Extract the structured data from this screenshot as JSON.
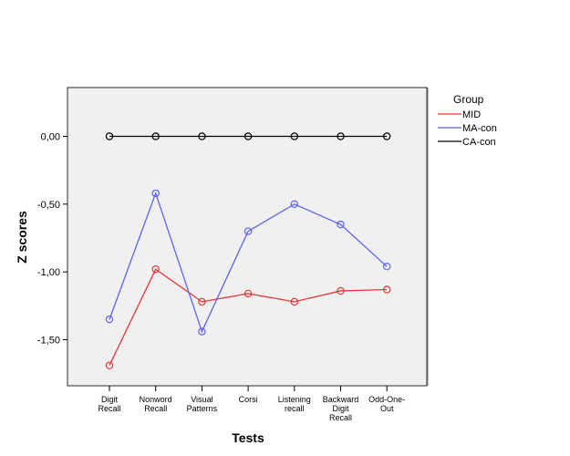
{
  "chart_data": {
    "type": "line",
    "title": "",
    "xlabel": "Tests",
    "ylabel": "Z scores",
    "ylim": [
      -1.84,
      0.36
    ],
    "yticks": [
      0.0,
      -0.5,
      -1.0,
      -1.5
    ],
    "ytick_labels": [
      "0,00",
      "-0,50",
      "-1,00",
      "-1,50"
    ],
    "grid": false,
    "categories": [
      [
        "Digit",
        "Recall"
      ],
      [
        "Nonword",
        "Recall"
      ],
      [
        "Visual",
        "Patterns"
      ],
      [
        "Corsi"
      ],
      [
        "Listening",
        "recall"
      ],
      [
        "Backward",
        "Digit",
        "Recall"
      ],
      [
        "Odd-One-",
        "Out"
      ]
    ],
    "legend": {
      "title": "Group",
      "placement": "right"
    },
    "series": [
      {
        "name": "MID",
        "color": "#e8363a",
        "values": [
          -1.69,
          -0.98,
          -1.22,
          -1.16,
          -1.22,
          -1.14,
          -1.13
        ]
      },
      {
        "name": "MA-con",
        "color": "#5c62ee",
        "values": [
          -1.35,
          -0.42,
          -1.44,
          -0.7,
          -0.5,
          -0.65,
          -0.96
        ]
      },
      {
        "name": "CA-con",
        "color": "#000000",
        "values": [
          0.0,
          0.0,
          0.0,
          0.0,
          0.0,
          0.0,
          0.0
        ]
      }
    ]
  }
}
